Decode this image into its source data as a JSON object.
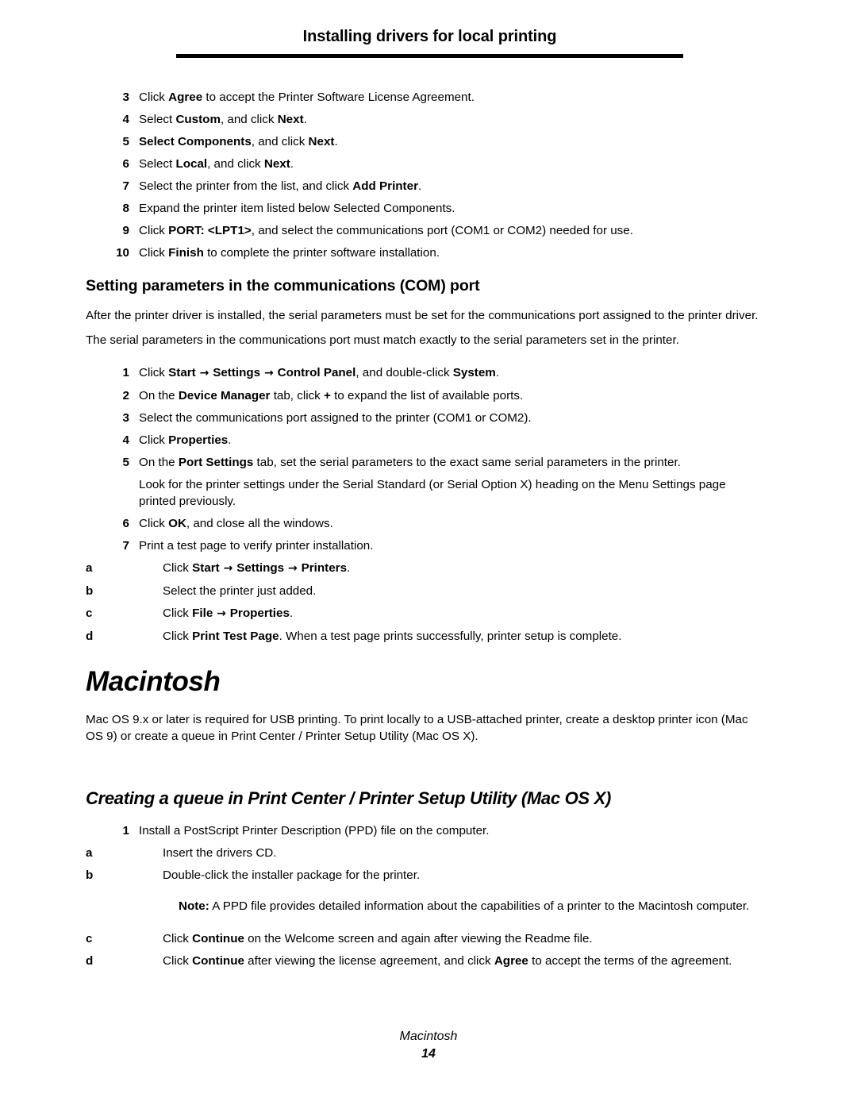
{
  "header": {
    "running_title": "Installing drivers for local printing"
  },
  "install_steps": [
    {
      "num": "3",
      "parts": [
        {
          "t": "Click ",
          "b": false
        },
        {
          "t": "Agree",
          "b": true
        },
        {
          "t": " to accept the Printer Software License Agreement.",
          "b": false
        }
      ]
    },
    {
      "num": "4",
      "parts": [
        {
          "t": "Select ",
          "b": false
        },
        {
          "t": "Custom",
          "b": true
        },
        {
          "t": ", and click ",
          "b": false
        },
        {
          "t": "Next",
          "b": true
        },
        {
          "t": ".",
          "b": false
        }
      ]
    },
    {
      "num": "5",
      "parts": [
        {
          "t": "Select Components",
          "b": true
        },
        {
          "t": ", and click ",
          "b": false
        },
        {
          "t": "Next",
          "b": true
        },
        {
          "t": ".",
          "b": false
        }
      ]
    },
    {
      "num": "6",
      "parts": [
        {
          "t": "Select ",
          "b": false
        },
        {
          "t": "Local",
          "b": true
        },
        {
          "t": ", and click ",
          "b": false
        },
        {
          "t": "Next",
          "b": true
        },
        {
          "t": ".",
          "b": false
        }
      ]
    },
    {
      "num": "7",
      "parts": [
        {
          "t": "Select the printer from the list, and click ",
          "b": false
        },
        {
          "t": "Add Printer",
          "b": true
        },
        {
          "t": ".",
          "b": false
        }
      ]
    },
    {
      "num": "8",
      "parts": [
        {
          "t": "Expand the printer item listed below Selected Components.",
          "b": false
        }
      ]
    },
    {
      "num": "9",
      "parts": [
        {
          "t": "Click ",
          "b": false
        },
        {
          "t": "PORT: <LPT1>",
          "b": true
        },
        {
          "t": ", and select the communications port (COM1 or COM2) needed for use.",
          "b": false
        }
      ]
    },
    {
      "num": "10",
      "parts": [
        {
          "t": "Click ",
          "b": false
        },
        {
          "t": "Finish",
          "b": true
        },
        {
          "t": " to complete the printer software installation.",
          "b": false
        }
      ]
    }
  ],
  "com_section": {
    "heading": "Setting parameters in the communications (COM) port",
    "intro_1": "After the printer driver is installed, the serial parameters must be set for the communications port assigned to the printer driver.",
    "intro_2": "The serial parameters in the communications port must match exactly to the serial parameters set in the printer.",
    "steps": [
      {
        "num": "1",
        "parts": [
          {
            "t": "Click ",
            "b": false
          },
          {
            "t": "Start",
            "b": true
          },
          {
            "t": " → ",
            "b": true,
            "arrow": true
          },
          {
            "t": "Settings",
            "b": true
          },
          {
            "t": " → ",
            "b": true,
            "arrow": true
          },
          {
            "t": "Control Panel",
            "b": true
          },
          {
            "t": ", and double-click ",
            "b": false
          },
          {
            "t": "System",
            "b": true
          },
          {
            "t": ".",
            "b": false
          }
        ]
      },
      {
        "num": "2",
        "parts": [
          {
            "t": "On the ",
            "b": false
          },
          {
            "t": "Device Manager",
            "b": true
          },
          {
            "t": " tab, click ",
            "b": false
          },
          {
            "t": "+",
            "b": true
          },
          {
            "t": " to expand the list of available ports.",
            "b": false
          }
        ]
      },
      {
        "num": "3",
        "parts": [
          {
            "t": "Select the communications port assigned to the printer (COM1 or COM2).",
            "b": false
          }
        ]
      },
      {
        "num": "4",
        "parts": [
          {
            "t": "Click ",
            "b": false
          },
          {
            "t": "Properties",
            "b": true
          },
          {
            "t": ".",
            "b": false
          }
        ]
      },
      {
        "num": "5",
        "parts": [
          {
            "t": "On the ",
            "b": false
          },
          {
            "t": "Port Settings",
            "b": true
          },
          {
            "t": " tab, set the serial parameters to the exact same serial parameters in the printer.",
            "b": false
          }
        ]
      }
    ],
    "step5_note": "Look for the printer settings under the Serial Standard (or Serial Option X) heading on the Menu Settings page printed previously.",
    "steps_tail": [
      {
        "num": "6",
        "parts": [
          {
            "t": "Click ",
            "b": false
          },
          {
            "t": "OK",
            "b": true
          },
          {
            "t": ", and close all the windows.",
            "b": false
          }
        ]
      },
      {
        "num": "7",
        "parts": [
          {
            "t": "Print a test page to verify printer installation.",
            "b": false
          }
        ]
      }
    ],
    "substeps": [
      {
        "letter": "a",
        "parts": [
          {
            "t": "Click ",
            "b": false
          },
          {
            "t": "Start",
            "b": true
          },
          {
            "t": " → ",
            "b": true,
            "arrow": true
          },
          {
            "t": "Settings",
            "b": true
          },
          {
            "t": " → ",
            "b": true,
            "arrow": true
          },
          {
            "t": "Printers",
            "b": true
          },
          {
            "t": ".",
            "b": false
          }
        ]
      },
      {
        "letter": "b",
        "parts": [
          {
            "t": "Select the printer just added.",
            "b": false
          }
        ]
      },
      {
        "letter": "c",
        "parts": [
          {
            "t": "Click ",
            "b": false
          },
          {
            "t": "File",
            "b": true
          },
          {
            "t": " → ",
            "b": true,
            "arrow": true
          },
          {
            "t": "Properties",
            "b": true
          },
          {
            "t": ".",
            "b": false
          }
        ]
      },
      {
        "letter": "d",
        "parts": [
          {
            "t": "Click ",
            "b": false
          },
          {
            "t": "Print Test Page",
            "b": true
          },
          {
            "t": ". When a test page prints successfully, printer setup is complete.",
            "b": false
          }
        ]
      }
    ]
  },
  "macintosh": {
    "chapter_heading": "Macintosh",
    "intro": "Mac OS 9.x or later is required for USB printing. To print locally to a USB-attached printer, create a desktop printer icon (Mac OS 9) or create a queue in Print Center / Printer Setup Utility (Mac OS X).",
    "section_heading": "Creating a queue in Print Center / Printer Setup Utility (Mac OS X)",
    "steps": [
      {
        "num": "1",
        "parts": [
          {
            "t": "Install a PostScript Printer Description (PPD) file on the computer.",
            "b": false
          }
        ]
      }
    ],
    "substeps_ab": [
      {
        "letter": "a",
        "parts": [
          {
            "t": "Insert the drivers CD.",
            "b": false
          }
        ]
      },
      {
        "letter": "b",
        "parts": [
          {
            "t": "Double-click the installer package for the printer.",
            "b": false
          }
        ]
      }
    ],
    "note_parts": [
      {
        "t": "Note:",
        "b": true
      },
      {
        "t": "  A PPD file provides detailed information about the capabilities of a printer to the Macintosh computer.",
        "b": false
      }
    ],
    "substeps_cd": [
      {
        "letter": "c",
        "parts": [
          {
            "t": "Click ",
            "b": false
          },
          {
            "t": "Continue",
            "b": true
          },
          {
            "t": " on the Welcome screen and again after viewing the Readme file.",
            "b": false
          }
        ]
      },
      {
        "letter": "d",
        "parts": [
          {
            "t": "Click ",
            "b": false
          },
          {
            "t": "Continue",
            "b": true
          },
          {
            "t": " after viewing the license agreement, and click ",
            "b": false
          },
          {
            "t": "Agree",
            "b": true
          },
          {
            "t": " to accept the terms of the agreement.",
            "b": false
          }
        ]
      }
    ]
  },
  "footer": {
    "title": "Macintosh",
    "page_number": "14"
  }
}
